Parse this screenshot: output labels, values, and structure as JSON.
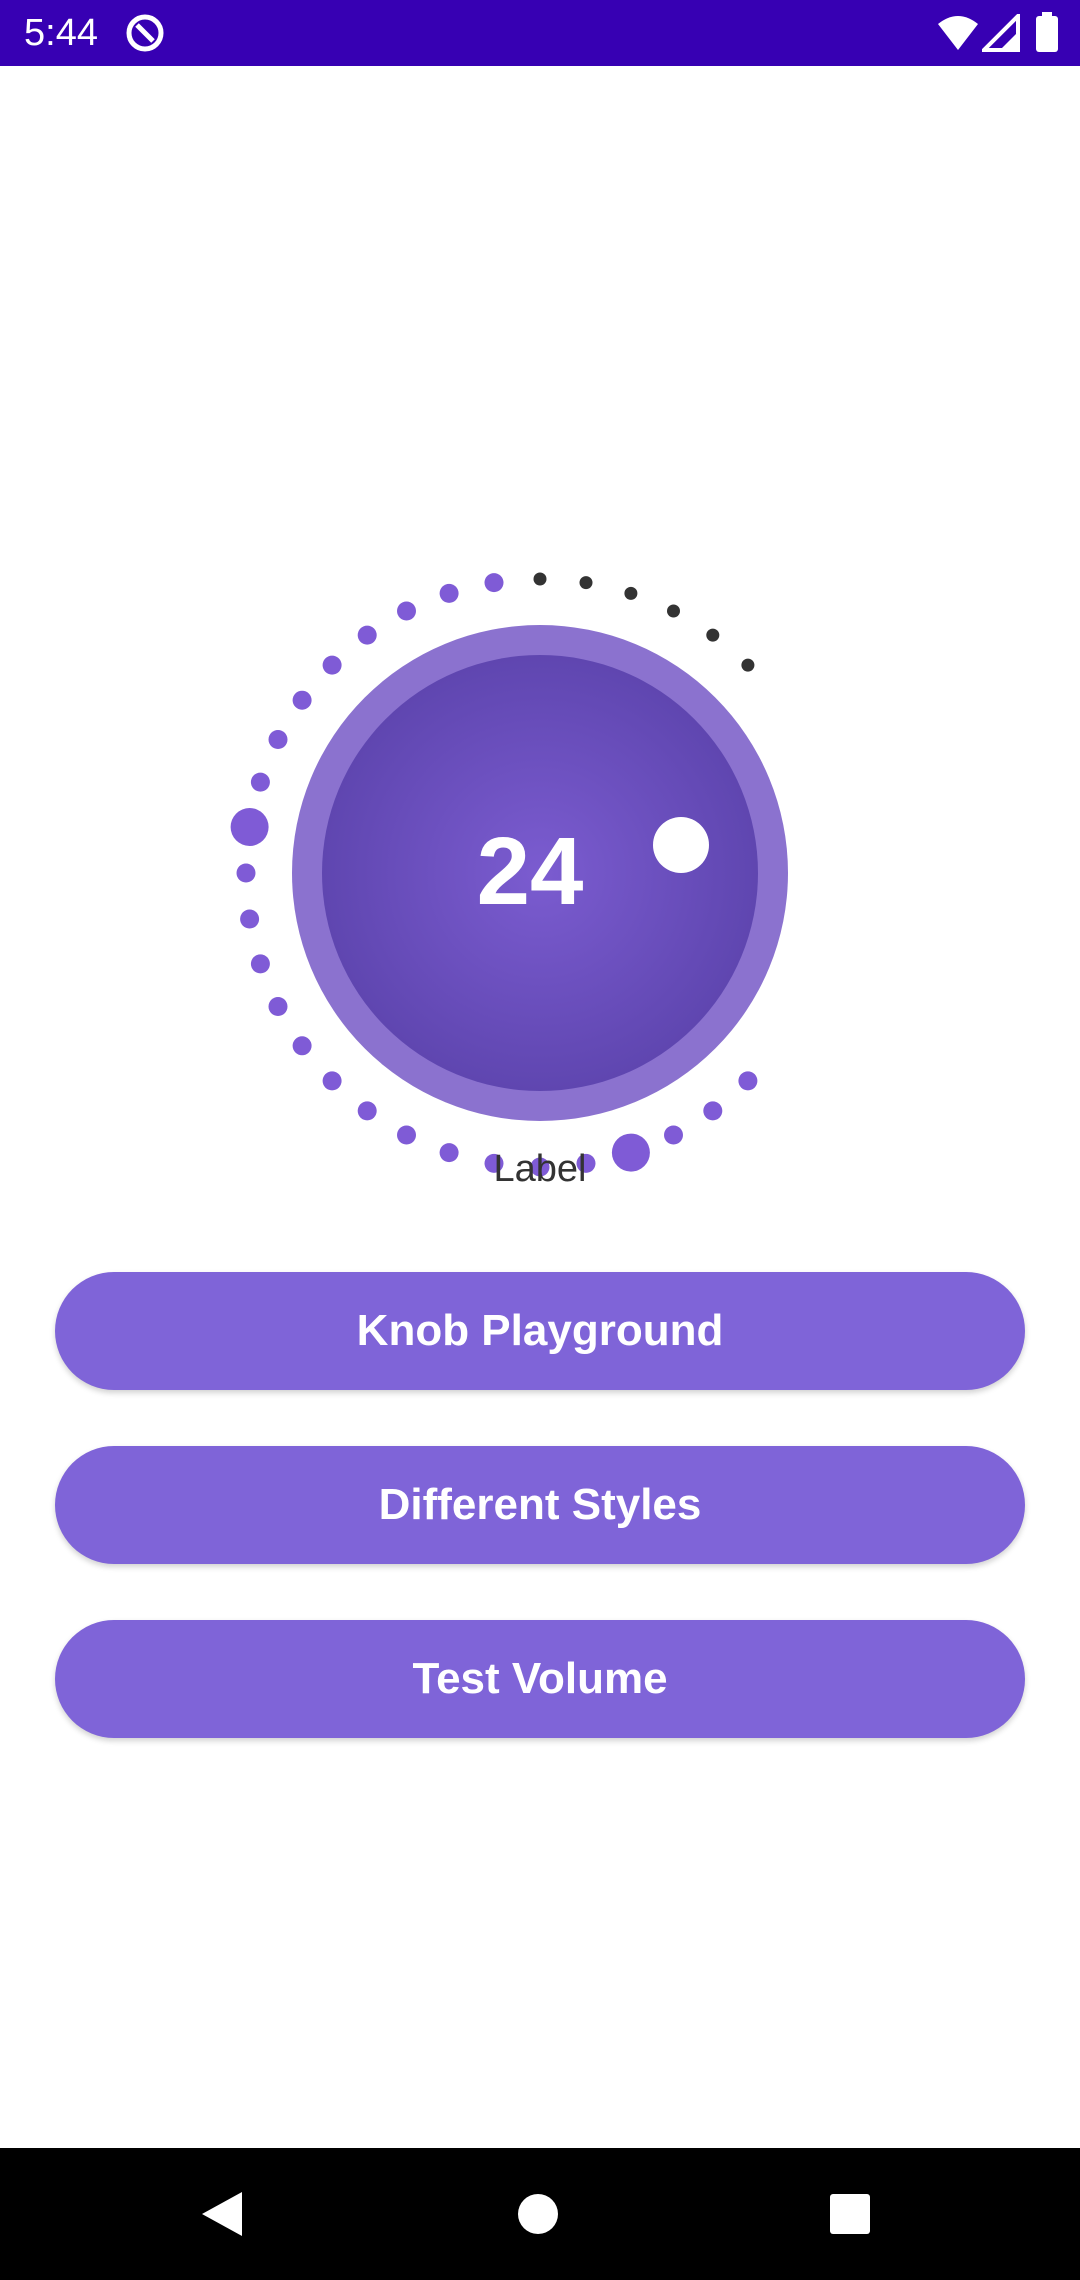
{
  "status_bar": {
    "time": "5:44",
    "icons": [
      "app-notification-icon",
      "wifi-icon",
      "signal-icon",
      "battery-icon"
    ]
  },
  "knob": {
    "value": "24",
    "label": "Label",
    "level_fraction": 0.8,
    "colors": {
      "active_dot": "#7f5bd6",
      "inactive_dot": "#333333",
      "outer_ring": "#8b72cf",
      "inner_center": "#7b5cd0",
      "inner_edge": "#5f46b0",
      "indicator": "#ffffff"
    }
  },
  "buttons": {
    "knob_playground": "Knob Playground",
    "different_styles": "Different Styles",
    "test_volume": "Test Volume"
  },
  "nav_bar": {
    "icons": [
      "back-icon",
      "home-icon",
      "recents-icon"
    ]
  }
}
